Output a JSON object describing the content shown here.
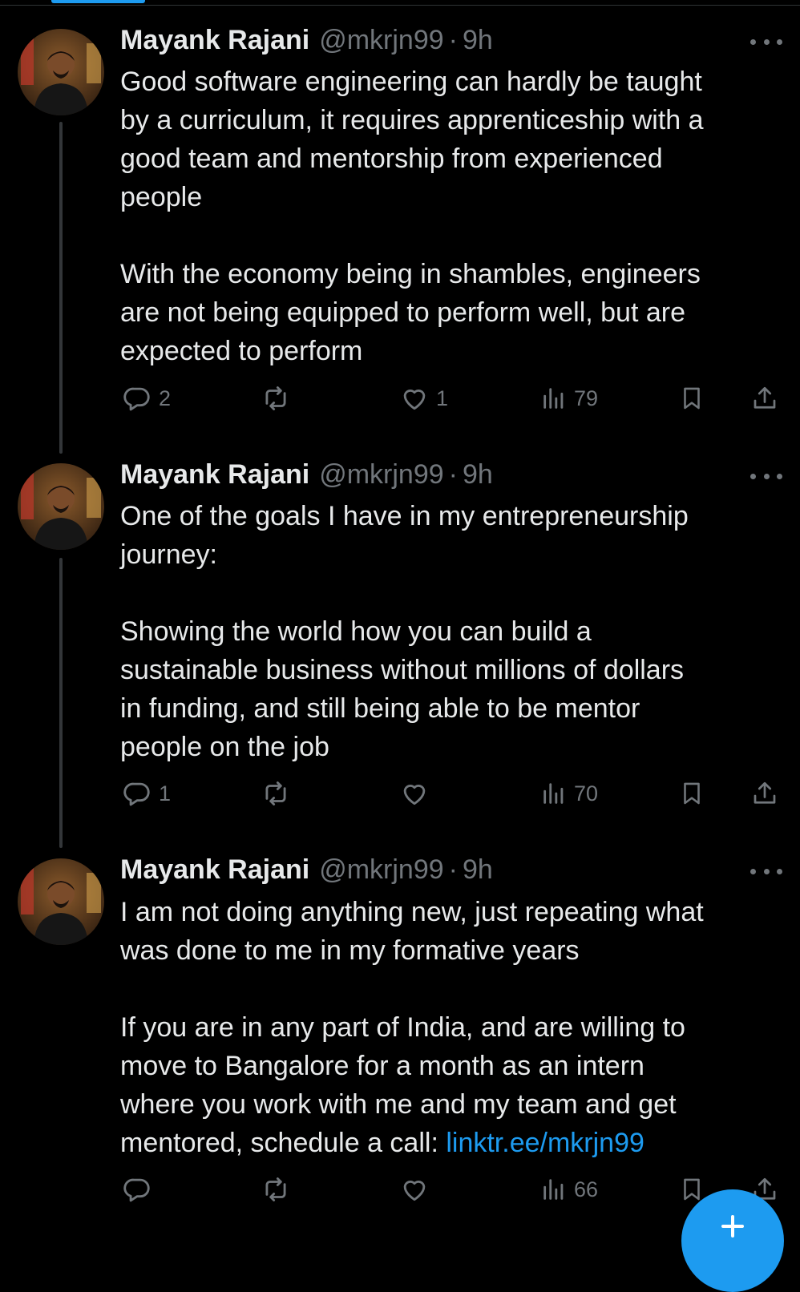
{
  "colors": {
    "background": "#000000",
    "text": "#e7e9ea",
    "secondary": "#71767b",
    "accent": "#1d9bf0",
    "thread_line": "#333639"
  },
  "icons": {
    "reply": "reply-icon",
    "repost": "repost-icon",
    "like": "heart-icon",
    "views": "views-icon",
    "bookmark": "bookmark-icon",
    "share": "share-icon",
    "more": "more-icon",
    "compose": "compose-plus-icon"
  },
  "tweets": [
    {
      "author": {
        "name": "Mayank Rajani",
        "handle": "@mkrjn99",
        "separator": "·",
        "time": "9h"
      },
      "paragraphs": [
        [
          "Good software engineering can hardly be taught",
          "by a curriculum, it requires apprenticeship with a",
          "good team and mentorship from experienced",
          "people"
        ],
        [
          "With the economy being in shambles, engineers",
          "are not being equipped to perform well, but are",
          "expected to perform"
        ]
      ],
      "stats": {
        "replies": "2",
        "reposts": "",
        "likes": "1",
        "views": "79"
      }
    },
    {
      "author": {
        "name": "Mayank Rajani",
        "handle": "@mkrjn99",
        "separator": "·",
        "time": "9h"
      },
      "paragraphs": [
        [
          "One of the goals I have in my entrepreneurship",
          "journey:"
        ],
        [
          "Showing the world how you can build a",
          "sustainable business without millions of dollars",
          "in funding, and still being able to be mentor",
          "people on the job"
        ]
      ],
      "stats": {
        "replies": "1",
        "reposts": "",
        "likes": "",
        "views": "70"
      }
    },
    {
      "author": {
        "name": "Mayank Rajani",
        "handle": "@mkrjn99",
        "separator": "·",
        "time": "9h"
      },
      "paragraphs": [
        [
          "I am not doing anything new, just repeating what",
          "was done to me in my formative years"
        ],
        [
          "If you are in any part of India, and are willing to",
          "move to Bangalore for a month as an intern",
          "where you work with me and my team and get"
        ]
      ],
      "last_line_prefix": "mentored, schedule a call: ",
      "link_text": "linktr.ee/mkrjn99",
      "stats": {
        "replies": "",
        "reposts": "",
        "likes": "",
        "views": "66"
      }
    }
  ]
}
